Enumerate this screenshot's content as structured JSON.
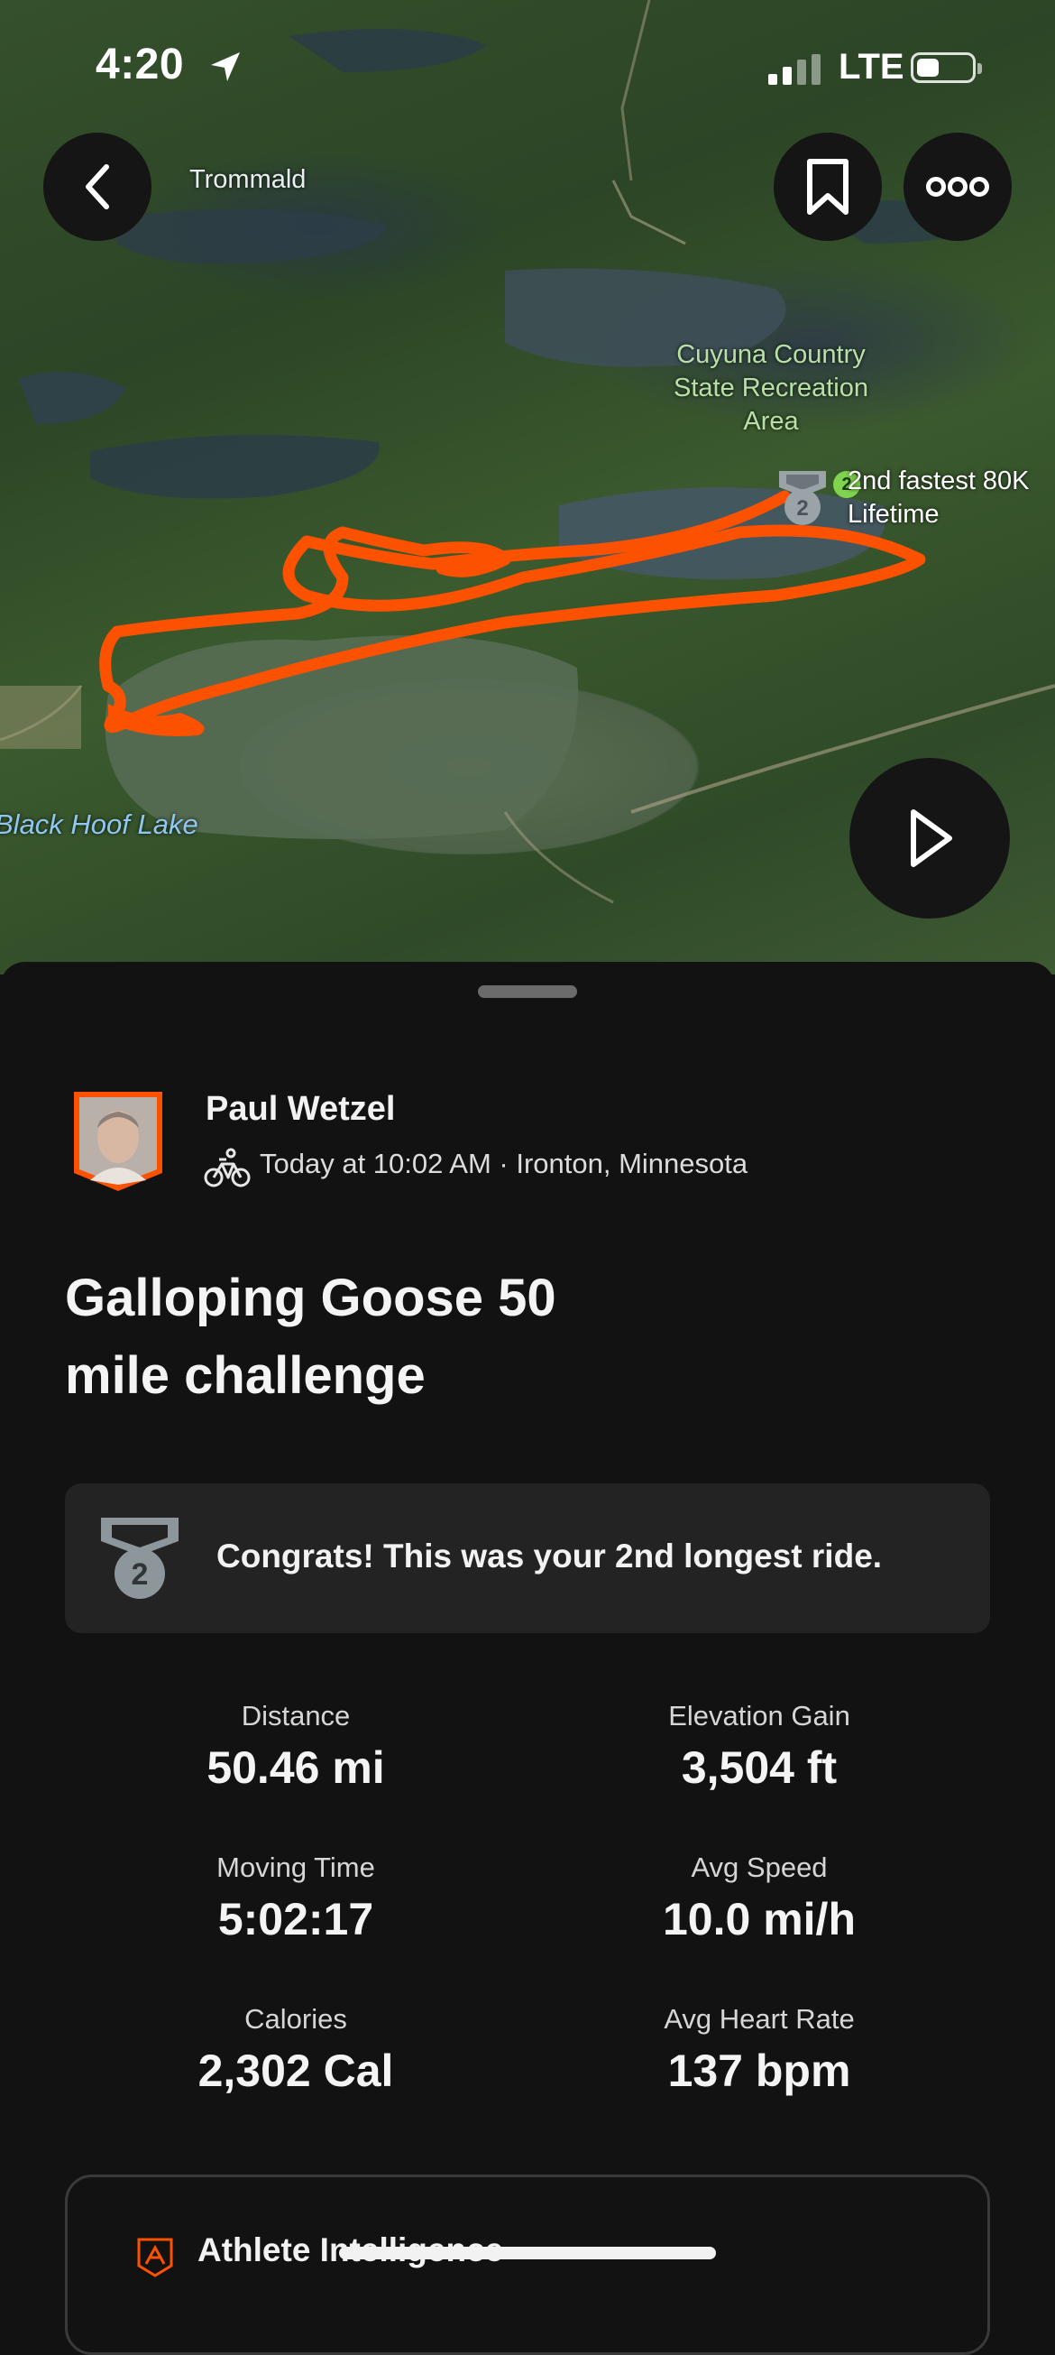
{
  "status_bar": {
    "time": "4:20",
    "network": "LTE",
    "battery_level": 0.4
  },
  "map": {
    "labels": {
      "town": "Trommald",
      "park_line1": "Cuyuna Country",
      "park_line2": "State Recreation",
      "park_line3": "Area",
      "lake": "Black Hoof Lake",
      "achievement_line1": "2nd fastest 80K",
      "achievement_line2": "Lifetime"
    },
    "medal_rank": "2",
    "route_color": "#fc5200"
  },
  "header_buttons": {
    "back": "chevron-left-icon",
    "bookmark": "bookmark-icon",
    "more": "more-icon"
  },
  "activity": {
    "athlete_name": "Paul Wetzel",
    "meta": "Today at 10:02 AM · Ironton, Minnesota",
    "title_line1": "Galloping Goose 50",
    "title_line2": "mile challenge",
    "congrats": "Congrats! This was your 2nd longest ride.",
    "medal_rank": "2"
  },
  "stats": [
    {
      "label": "Distance",
      "value": "50.46 mi"
    },
    {
      "label": "Elevation Gain",
      "value": "3,504 ft"
    },
    {
      "label": "Moving Time",
      "value": "5:02:17"
    },
    {
      "label": "Avg Speed",
      "value": "10.0 mi/h"
    },
    {
      "label": "Calories",
      "value": "2,302 Cal"
    },
    {
      "label": "Avg Heart Rate",
      "value": "137 bpm"
    }
  ],
  "athlete_intelligence": {
    "label": "Athlete Intelligence"
  },
  "colors": {
    "brand": "#fc5200",
    "background": "#121212",
    "card": "#232323"
  }
}
